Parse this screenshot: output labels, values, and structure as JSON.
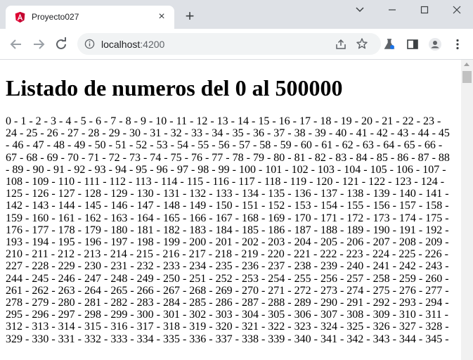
{
  "tab": {
    "title": "Proyecto027",
    "favicon": "angular-icon",
    "close": "×"
  },
  "newtab": "+",
  "address": {
    "host": "localhost",
    "port": ":4200"
  },
  "page": {
    "heading": "Listado de numeros del 0 al 500000",
    "range_start": 0,
    "range_end": 500000,
    "visible_last": 345,
    "separator": " - "
  },
  "colors": {
    "accent": "#dd0031",
    "frame": "#dee1e6",
    "toolbar_icons": "#5f6368"
  }
}
